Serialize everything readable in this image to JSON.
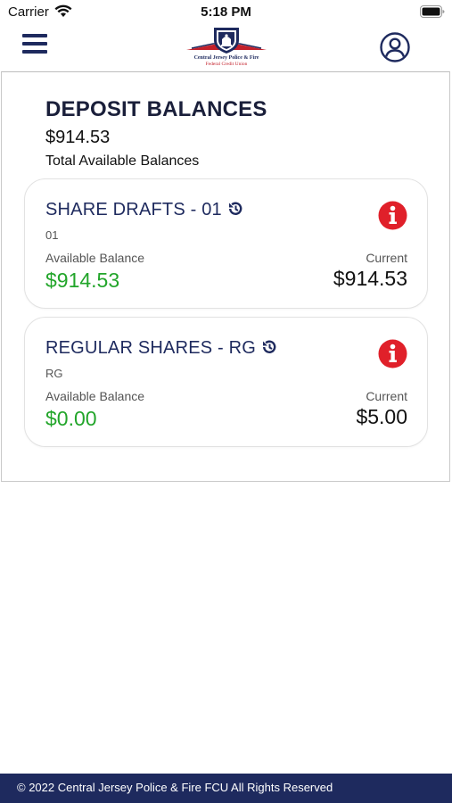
{
  "status_bar": {
    "carrier": "Carrier",
    "time": "5:18 PM"
  },
  "header": {
    "logo_line1": "Central Jersey Police & Fire",
    "logo_line2": "Federal Credit Union",
    "brand_navy": "#1e2a5e",
    "brand_red": "#c3202a"
  },
  "summary": {
    "title": "DEPOSIT BALANCES",
    "total_amount": "$914.53",
    "total_label": "Total Available Balances"
  },
  "accounts": [
    {
      "name": "SHARE DRAFTS - 01",
      "suffix": "01",
      "available_label": "Available Balance",
      "available_value": "$914.53",
      "current_label": "Current",
      "current_value": "$914.53"
    },
    {
      "name": "REGULAR SHARES - RG",
      "suffix": "RG",
      "available_label": "Available Balance",
      "available_value": "$0.00",
      "current_label": "Current",
      "current_value": "$5.00"
    }
  ],
  "icons": {
    "menu": "hamburger-menu-icon",
    "profile": "user-profile-icon",
    "history": "history-icon",
    "info": "info-icon"
  },
  "colors": {
    "available_green": "#22a52a",
    "info_red": "#e0202a"
  },
  "footer": {
    "text": "© 2022 Central Jersey Police & Fire FCU All Rights Reserved"
  }
}
